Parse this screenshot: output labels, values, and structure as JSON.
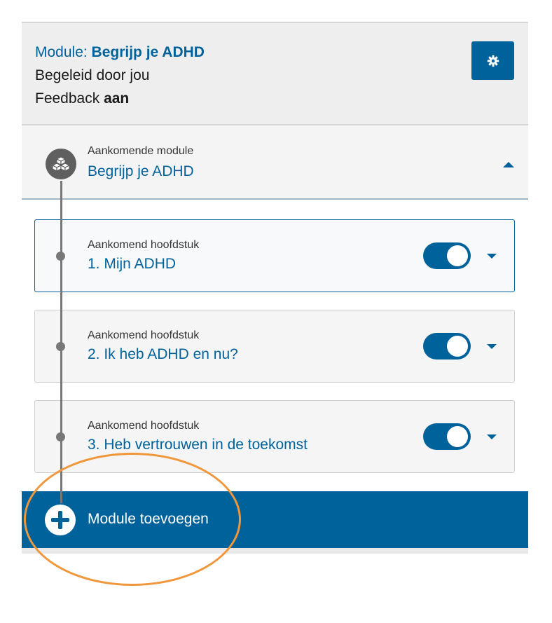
{
  "header": {
    "module_prefix": "Module: ",
    "module_name": "Begrijp je ADHD",
    "guided_by": "Begeleid door jou",
    "feedback_prefix": "Feedback ",
    "feedback_value": "aan",
    "settings_icon": "gear-icon"
  },
  "module": {
    "label": "Aankomende module",
    "title": "Begrijp je ADHD",
    "icon": "cubes-icon",
    "expanded": true
  },
  "chapters": [
    {
      "label": "Aankomend hoofdstuk",
      "title": "1. Mijn ADHD",
      "enabled": true,
      "active": true
    },
    {
      "label": "Aankomend hoofdstuk",
      "title": "2. Ik heb ADHD en nu?",
      "enabled": true,
      "active": false
    },
    {
      "label": "Aankomend hoofdstuk",
      "title": "3. Heb vertrouwen in de toekomst",
      "enabled": true,
      "active": false
    }
  ],
  "add_module": {
    "label": "Module toevoegen",
    "icon": "plus-circle-icon"
  },
  "colors": {
    "primary": "#00629b",
    "header_bg": "#eeeeee",
    "annotation": "#f0973b"
  }
}
